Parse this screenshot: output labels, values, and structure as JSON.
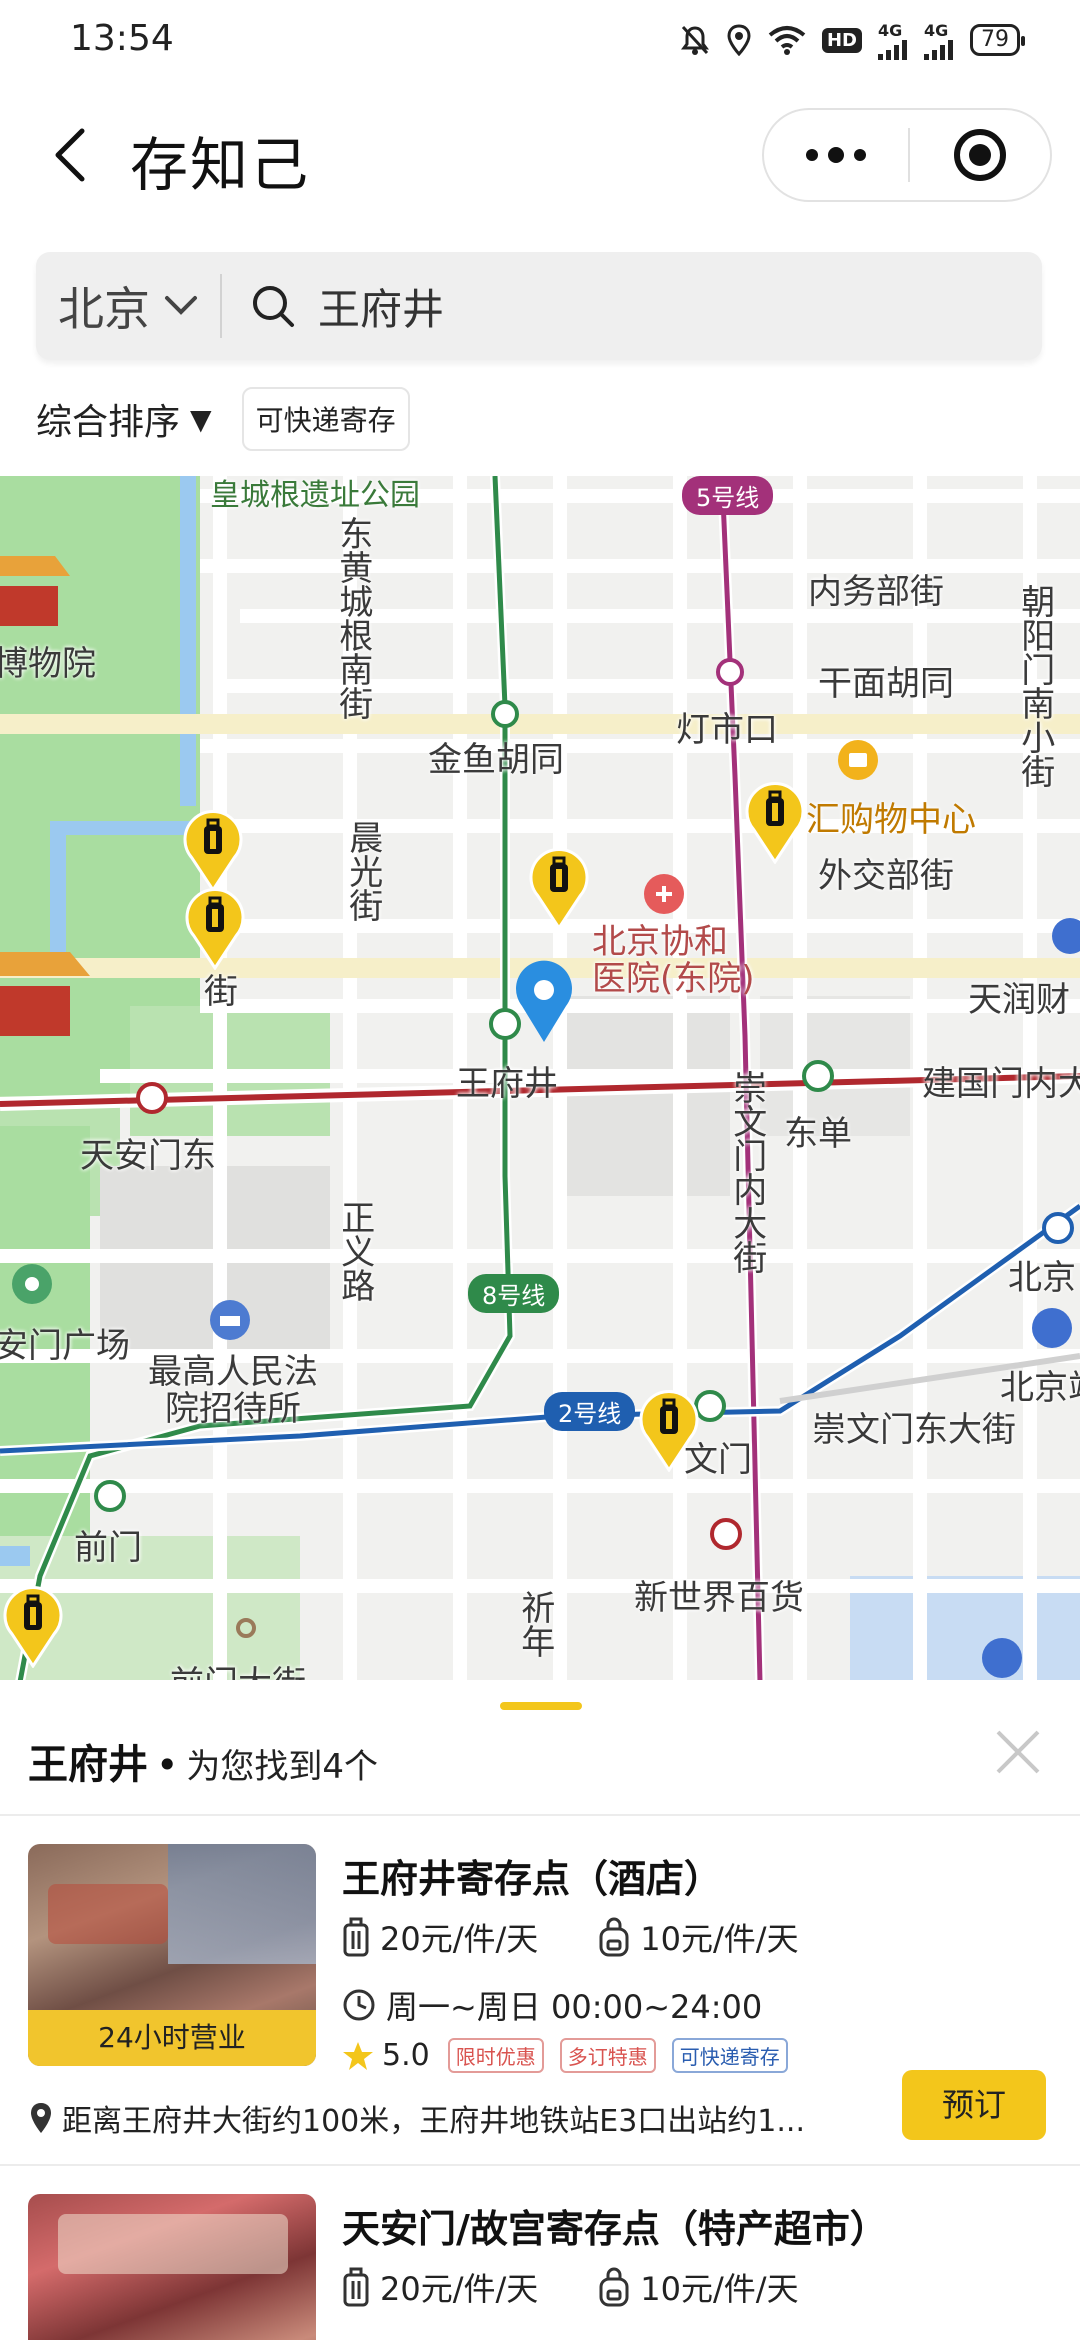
{
  "status_bar": {
    "time": "13:54",
    "hd": "HD",
    "signal1": "4G",
    "signal2": "4G",
    "battery": "79"
  },
  "header": {
    "title": "存知己"
  },
  "search": {
    "city": "北京",
    "query": "王府井"
  },
  "filters": {
    "sort_label": "综合排序",
    "sort_caret": "▼",
    "chip_express": "可快递寄存"
  },
  "map": {
    "labels": {
      "park": "皇城根遗址公园",
      "museum": "博物院",
      "donghuangchenggen": "东黄城根南街",
      "neiwubu": "内务部街",
      "chaoyangmen": "朝阳门南小街",
      "ganmian": "干面胡同",
      "dengshikou": "灯市口",
      "jinyu": "金鱼胡同",
      "mall": "汇购物中心",
      "waijiaobu": "外交部街",
      "chenguang": "晨光街",
      "jie": "街",
      "xiehe": "北京协和医院(东院)",
      "tianrun": "天润财",
      "wangfujing": "王府井",
      "dongdan": "东单",
      "jianguomen": "建国门内大",
      "tiananmendong": "天安门东",
      "chongwenmennei": "崇文门内大街",
      "zhengyi": "正义路",
      "beijing_station": "北京",
      "square": "安门广场",
      "court_hotel": "最高人民法院招待所",
      "chongwenmendong": "崇文门东大街",
      "beijingzhan2": "北京站",
      "wenmen": "文门",
      "qianmen": "前门",
      "xinshijie": "新世界百货",
      "qiannian": "祈年",
      "qianmendajie": "前门大街"
    },
    "line_badges": {
      "line5": "5号线",
      "line8": "8号线",
      "line2": "2号线"
    },
    "colors": {
      "line5": "#a3317a",
      "line8": "#2f8a4a",
      "line2": "#1f5fb0",
      "line1": "#b0282e",
      "pin": "#f3c61b",
      "location": "#2a8ee0"
    }
  },
  "results": {
    "place": "王府井",
    "dot": "•",
    "count_text": "为您找到4个",
    "items": [
      {
        "title": "王府井寄存点（酒店）",
        "price_large": "20元/件/天",
        "price_small": "10元/件/天",
        "hours": "周一~周日 00:00~24:00",
        "rating": "5.0",
        "badges": [
          "限时优惠",
          "多订特惠",
          "可快递寄存"
        ],
        "thumb_tag": "24小时营业",
        "distance": "距离王府井大街约100米，王府井地铁站E3口出站约1...",
        "book_label": "预订"
      },
      {
        "title": "天安门/故宫寄存点（特产超市）",
        "price_large": "20元/件/天",
        "price_small": "10元/件/天"
      }
    ]
  }
}
